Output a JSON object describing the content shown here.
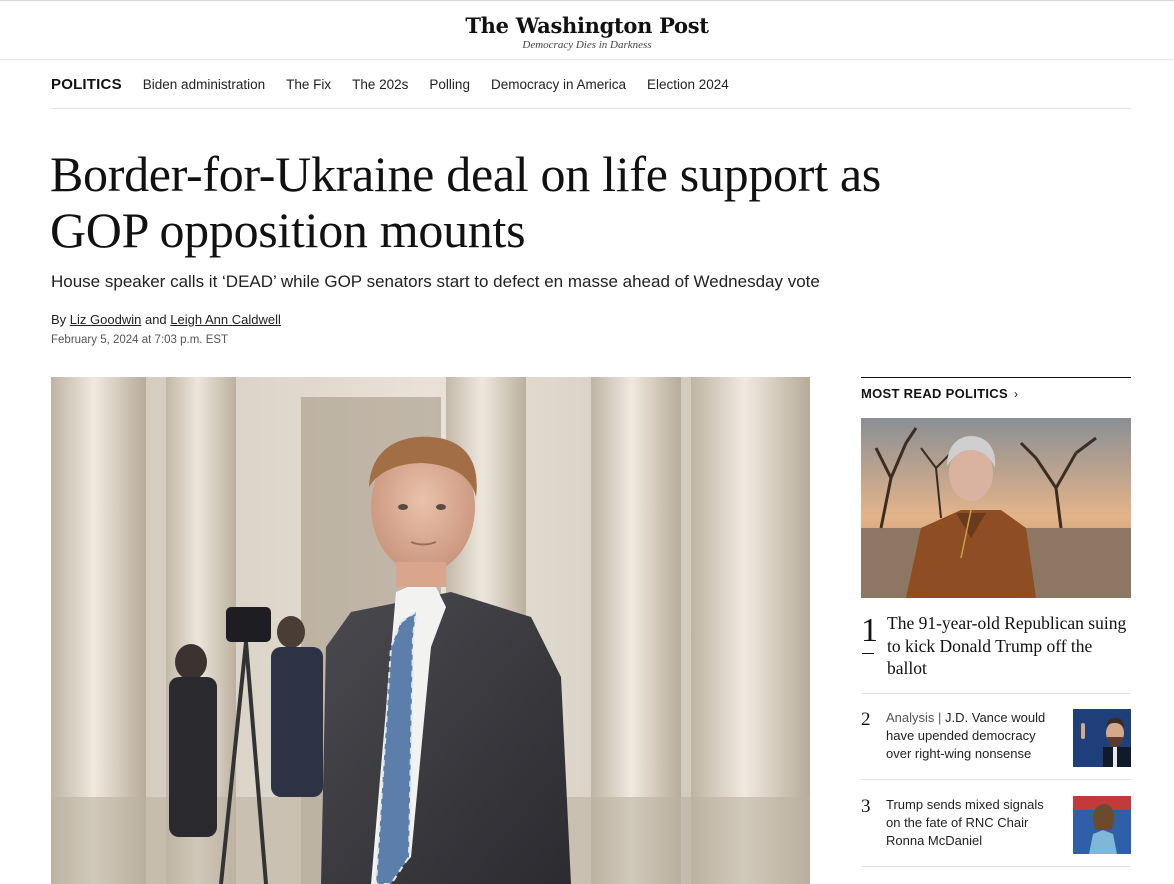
{
  "masthead": {
    "logo": "The Washington Post",
    "tagline": "Democracy Dies in Darkness"
  },
  "subnav": {
    "section": "POLITICS",
    "links": [
      "Biden administration",
      "The Fix",
      "The 202s",
      "Polling",
      "Democracy in America",
      "Election 2024"
    ]
  },
  "article": {
    "headline": "Border-for-Ukraine deal on life support as GOP opposition mounts",
    "dek": "House speaker calls it ‘DEAD’ while GOP senators start to defect en masse ahead of Wednesday vote",
    "byline_prefix": "By",
    "author1": "Liz Goodwin",
    "byline_and": "and",
    "author2": "Leigh Ann Caldwell",
    "timestamp": "February 5, 2024 at 7:03 p.m. EST"
  },
  "sidebar": {
    "title": "MOST READ POLITICS",
    "chevron": "›",
    "items": [
      {
        "number": "1",
        "text": "The 91-year-old Republican suing to kick Donald Trump off the ballot"
      },
      {
        "number": "2",
        "label": "Analysis | ",
        "text": "J.D. Vance would have upended democracy over right-wing nonsense"
      },
      {
        "number": "3",
        "text": "Trump sends mixed signals on the fate of RNC Chair Ronna McDaniel"
      }
    ]
  },
  "colors": {
    "text": "#111111",
    "rule": "#e4e4e4",
    "muted": "#555555"
  }
}
